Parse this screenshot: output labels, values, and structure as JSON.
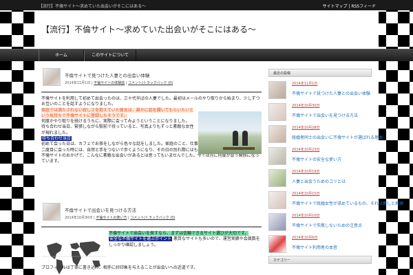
{
  "topbar": {
    "tagline": "【流行】不倫サイト〜求めていた出会いがそこにはある〜",
    "links_prefix": "サイトマップ",
    "links_sep": " | ",
    "links_rss": "RSSフィード"
  },
  "header": {
    "title": "【流行】不倫サイト〜求めていた出会いがそこにはある〜"
  },
  "nav": {
    "home": "ホーム",
    "about": "このサイトについて"
  },
  "posts": [
    {
      "title": "不倫サイトで見つけた人妻との出会い体験",
      "meta_date": "2014年11月1日",
      "meta_sep": " | ",
      "meta_category": "不倫サイトの体験談",
      "meta_comments": "コメント/トラックバック (0)",
      "lines": [
        "不倫サイトを利用して初めて出会ったのは、三十代半ばの人妻でした。最初はメールのやり取りから始まり、少しずつお互いのことを話すようになりました。",
        "家庭では満たされない寂しさを抱えていた彼女は、誰かに話を聞いてもらいたいという気持ちで不倫サイトに登録したそうです。",
        "何度かやり取りを続けるうちに、実際に会ってみようということになりました。",
        "待ち合わせ当日、緊張しながら駅前で待っていると、写真よりもずっと素敵な女性が現れました。",
        "初めて会った日は、カフェでお茶をしながら色々な話をしました。家庭のこと、仕事のこと、趣味のこと。",
        "二度目に会った時には、自然と手をつないで歩くようになり、その日の別れ際にはもう次に会う約束をしていました。",
        "不倫サイトのおかげで、こんなに素敵な出会いがあるとは思ってもいませんでした。今では月に何度か会う関係になっています。"
      ],
      "highlight_orange": "家庭では満たされない寂しさを抱えていた彼女は、誰かに話を聞いてもらいたいという気持ちで不倫サイトに登録したそうです。",
      "highlight_blue": "待ち合わせ当日"
    },
    {
      "title": "不倫サイトで出会いを見つける方法",
      "meta_date": "2014年10月30日",
      "meta_sep": " | ",
      "meta_category": "不倫サイトの使い方",
      "meta_comments": "コメント/トラックバック (0)",
      "highlight_green": "不倫サイトで出会いを探すなら、まずは信頼できるサイト選びが大切です。",
      "highlight_blue": "安全な不倫サイトを選ぶポイント",
      "line_after": "悪質なサイトも多いので、運営実績や会員数をしっかり確認しましょう。",
      "line_full": "プロフィールは丁寧に書き込み、相手に好印象を与えることが出会いへの近道です。"
    }
  ],
  "sidebar": {
    "recent_heading": "最近の投稿",
    "recent": [
      {
        "date": "2014年11月1日",
        "title": "不倫サイトで見つけた人妻との出会い体験"
      },
      {
        "date": "2014年10月30日",
        "title": "不倫サイトで出会いを見つける方法"
      },
      {
        "date": "2014年10月28日",
        "title": "既婚者同士の出会いに不倫サイトが選ばれる理由"
      },
      {
        "date": "2014年10月23日",
        "title": "不倫サイトの安全な使い方"
      },
      {
        "date": "2014年10月19日",
        "title": "人妻と出会うためのコツとは"
      },
      {
        "date": "2014年10月15日",
        "title": "不倫サイトで既婚女性が求めているもの、それは癒しと刺激"
      },
      {
        "date": "2014年10月10日",
        "title": "不倫サイトで失敗しないための注意点"
      },
      {
        "date": "2014年10月6日",
        "title": "不倫サイト利用者の本音"
      }
    ],
    "second_heading": "カテゴリー"
  },
  "colors": {
    "accent_link": "#1e6fb8",
    "date_red": "#c0392b",
    "highlight_orange_text": "#e2501a",
    "highlight_blue_bg": "#1b2c8c",
    "highlight_green_bg": "#6fe2a4"
  }
}
